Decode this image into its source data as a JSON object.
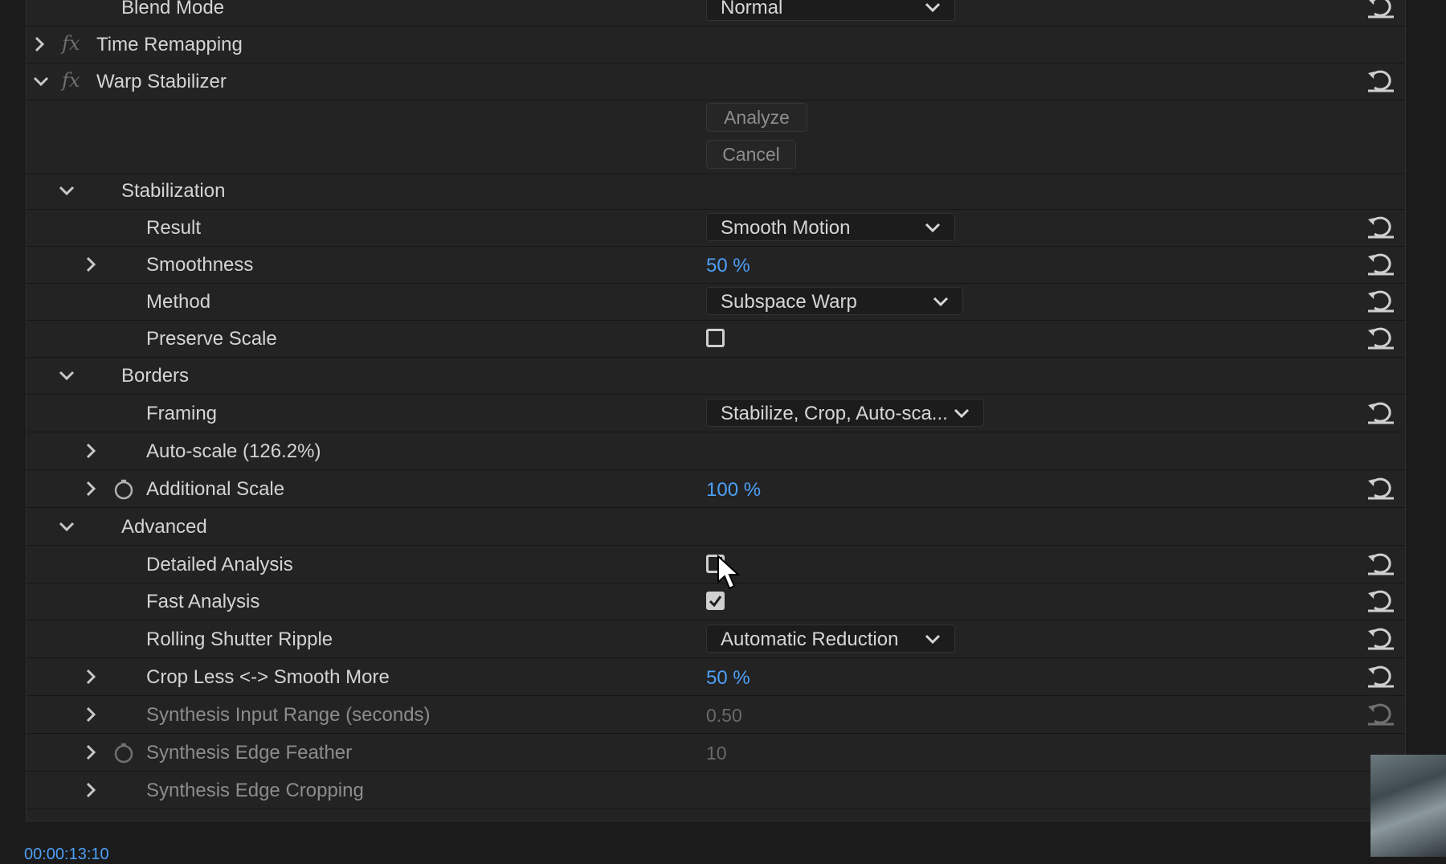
{
  "rows": {
    "blend_mode": {
      "label": "Blend Mode",
      "value": "Normal"
    },
    "time_remapping": {
      "label": "Time Remapping"
    },
    "warp_stabilizer": {
      "label": "Warp Stabilizer"
    },
    "analyze": {
      "label": "Analyze"
    },
    "cancel": {
      "label": "Cancel"
    },
    "stabilization": {
      "label": "Stabilization"
    },
    "result": {
      "label": "Result",
      "value": "Smooth Motion"
    },
    "smoothness": {
      "label": "Smoothness",
      "value": "50 %"
    },
    "method": {
      "label": "Method",
      "value": "Subspace Warp"
    },
    "preserve_scale": {
      "label": "Preserve Scale",
      "checked": false
    },
    "borders": {
      "label": "Borders"
    },
    "framing": {
      "label": "Framing",
      "value": "Stabilize, Crop, Auto-sca..."
    },
    "auto_scale": {
      "label": "Auto-scale (126.2%)"
    },
    "additional_scale": {
      "label": "Additional Scale",
      "value": "100 %"
    },
    "advanced": {
      "label": "Advanced"
    },
    "detailed_analysis": {
      "label": "Detailed Analysis",
      "checked": false
    },
    "fast_analysis": {
      "label": "Fast Analysis",
      "checked": true
    },
    "rolling_shutter": {
      "label": "Rolling Shutter Ripple",
      "value": "Automatic Reduction"
    },
    "crop_less": {
      "label": "Crop Less <-> Smooth More",
      "value": "50 %"
    },
    "synthesis_input": {
      "label": "Synthesis Input Range (seconds)",
      "value": "0.50"
    },
    "synthesis_feather": {
      "label": "Synthesis Edge Feather",
      "value": "10"
    },
    "synthesis_cropping": {
      "label": "Synthesis Edge Cropping"
    }
  },
  "footer": {
    "timecode": "00:00:13:10"
  },
  "colors": {
    "accent_value": "#4d9ff5",
    "panel_bg": "#232323"
  },
  "icons": [
    "chevron-right-icon",
    "chevron-down-icon",
    "fx-icon",
    "reset-icon",
    "stopwatch-icon",
    "dropdown-arrow-icon",
    "checkmark-icon",
    "mouse-cursor-icon"
  ]
}
